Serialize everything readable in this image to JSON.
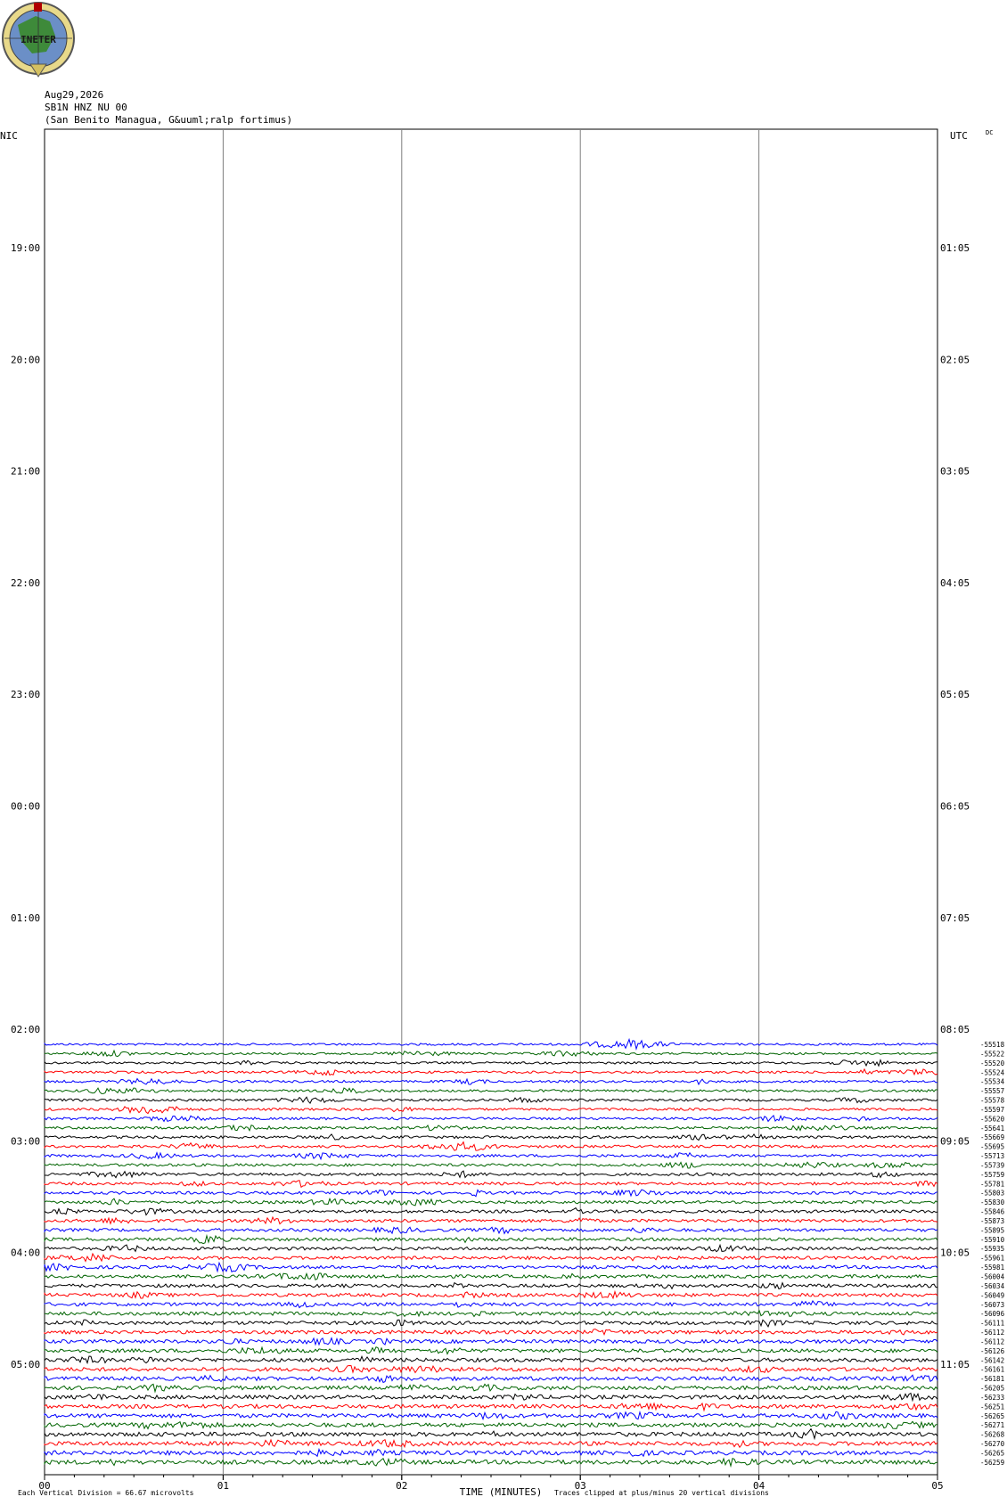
{
  "header": {
    "logo_text": "INETER",
    "date": "Aug29,2026",
    "station": "SB1N HNZ NU 00",
    "location": "(San Benito Managua, G&uuml;ralp fortimus)"
  },
  "left_zone_label": "NIC",
  "right_zone_label": "UTC",
  "dc_label": "DC",
  "footer": {
    "scale_text": "Each Vertical Division =   66.67 microvolts",
    "xlabel": "TIME (MINUTES)",
    "clip_text": "Traces clipped at plus/minus 20 vertical divisions"
  },
  "colors": {
    "black": "#000000",
    "red": "#ff0000",
    "blue": "#0000ff",
    "green": "#006400",
    "grid": "#7f7f7f"
  },
  "chart_data": {
    "type": "line",
    "title": "SB1N HNZ NU 00",
    "xlabel": "TIME (MINUTES)",
    "x_tick_labels": [
      "00",
      "01",
      "02",
      "03",
      "04",
      "05"
    ],
    "xlim": [
      0,
      5
    ],
    "left_time_labels": [
      "19:00",
      "20:00",
      "21:00",
      "22:00",
      "23:00",
      "00:00",
      "01:00",
      "02:00",
      "03:00",
      "04:00",
      "05:00"
    ],
    "right_time_labels": [
      "01:05",
      "02:05",
      "03:05",
      "04:05",
      "05:05",
      "06:05",
      "07:05",
      "08:05",
      "09:05",
      "10:05",
      "11:05"
    ],
    "trace_color_cycle": [
      "blue",
      "green",
      "black",
      "red"
    ],
    "first_trace_color_index": 0,
    "amplitude_labels": [
      "-55518",
      "-55522",
      "-55520",
      "-55524",
      "-55534",
      "-55557",
      "-55578",
      "-55597",
      "-55620",
      "-55641",
      "-55669",
      "-55695",
      "-55713",
      "-55739",
      "-55759",
      "-55781",
      "-55803",
      "-55830",
      "-55846",
      "-55873",
      "-55895",
      "-55910",
      "-55935",
      "-55961",
      "-55981",
      "-56004",
      "-56034",
      "-56049",
      "-56073",
      "-56096",
      "-56111",
      "-56112",
      "-56112",
      "-56126",
      "-56142",
      "-56161",
      "-56181",
      "-56205",
      "-56233",
      "-56251",
      "-56265",
      "-56271",
      "-56268",
      "-56270",
      "-56265",
      "-56259"
    ]
  }
}
